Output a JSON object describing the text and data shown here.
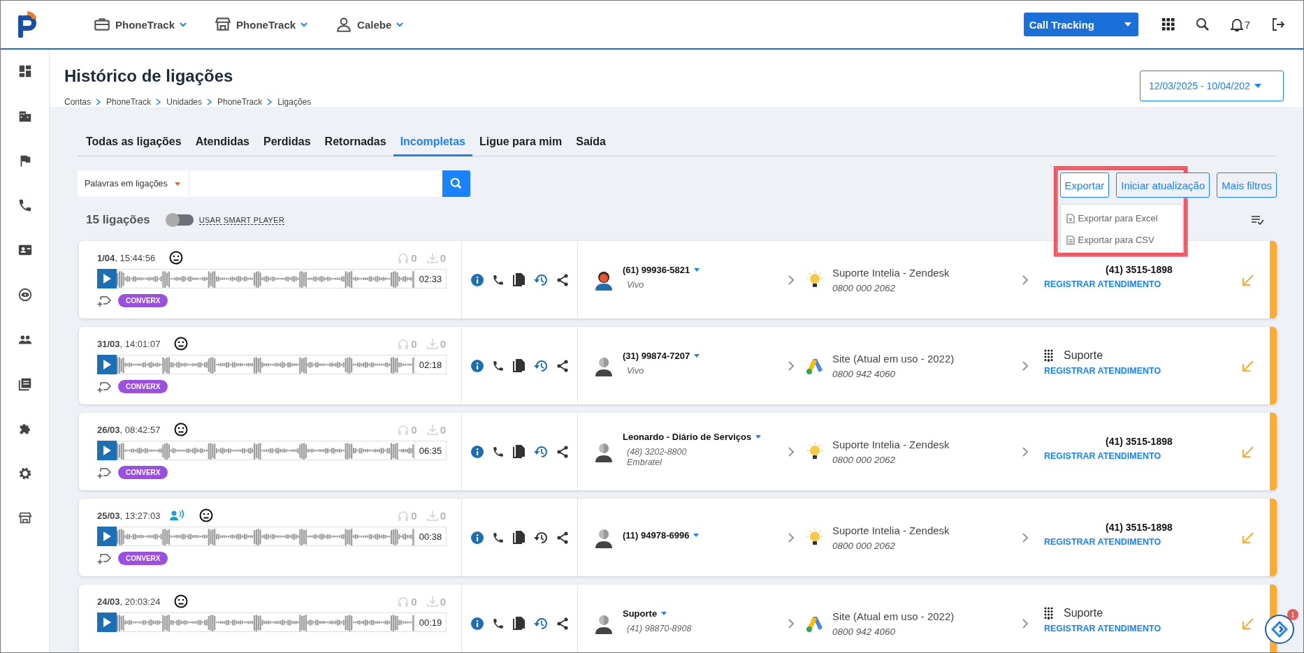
{
  "topbar": {
    "menus": [
      {
        "label": "PhoneTrack"
      },
      {
        "label": "PhoneTrack"
      },
      {
        "label": "Calebe"
      }
    ],
    "product": "Call Tracking",
    "notifications": "7"
  },
  "sidebar": {
    "items": [
      {
        "kind": "dashboard"
      },
      {
        "kind": "building"
      },
      {
        "kind": "flag"
      },
      {
        "kind": "phone"
      },
      {
        "kind": "contact"
      },
      {
        "kind": "target"
      },
      {
        "kind": "people"
      },
      {
        "kind": "book"
      },
      {
        "kind": "puzzle"
      },
      {
        "kind": "gear"
      },
      {
        "kind": "store"
      }
    ]
  },
  "header": {
    "title": "Histórico de ligações",
    "breadcrumb": [
      "Contas",
      "PhoneTrack",
      "Unidades",
      "PhoneTrack",
      "Ligações"
    ],
    "date_range": "12/03/2025 - 10/04/202"
  },
  "tabs": [
    {
      "label": "Todas as ligações",
      "selected": false
    },
    {
      "label": "Atendidas",
      "selected": false
    },
    {
      "label": "Perdidas",
      "selected": false
    },
    {
      "label": "Retornadas",
      "selected": false
    },
    {
      "label": "Incompletas",
      "selected": true
    },
    {
      "label": "Ligue para mim",
      "selected": false
    },
    {
      "label": "Saída",
      "selected": false
    }
  ],
  "search": {
    "filter": "Palavras em ligações"
  },
  "actions": [
    {
      "label": "Exportar",
      "expanded": true
    },
    {
      "label": "Iniciar atualização",
      "expanded": false
    },
    {
      "label": "Mais filtros",
      "expanded": false
    }
  ],
  "export_menu": {
    "highlighted": true,
    "items": [
      {
        "kind": "excel",
        "label": "Exportar para Excel"
      },
      {
        "kind": "csv",
        "label": "Exportar para CSV"
      }
    ]
  },
  "summary": {
    "count": "15 ligações",
    "smart_player": {
      "label": "USAR SMART PLAYER",
      "on": false
    }
  },
  "calls": [
    {
      "datetime": "**1/04**, 15:44:56",
      "transcribed": false,
      "plays": "0",
      "downloads": "0",
      "duration": "02:33",
      "tags": [
        "CONVERX"
      ],
      "history_highlighted": true,
      "caller": {
        "kind": "woman",
        "name": "(61) 99936-5821",
        "lines": [
          "Vivo"
        ]
      },
      "source": {
        "kind": "bulb",
        "name": "Suporte Intelia - Zendesk",
        "number": "0800 000 2062"
      },
      "destination": {
        "kind": "phone",
        "label": "(41) 3515-1898",
        "action": "REGISTRAR ATENDIMENTO"
      }
    },
    {
      "datetime": "**31/03**, 14:01:07",
      "transcribed": false,
      "plays": "0",
      "downloads": "0",
      "duration": "02:18",
      "tags": [
        "CONVERX"
      ],
      "history_highlighted": true,
      "caller": {
        "kind": "person",
        "name": "(31) 99874-7207",
        "lines": [
          "Vivo"
        ]
      },
      "source": {
        "kind": "ads",
        "name": "Site (Atual em uso - 2022)",
        "number": "0800 942 4060"
      },
      "destination": {
        "kind": "menu",
        "label": "Suporte",
        "action": "REGISTRAR ATENDIMENTO"
      }
    },
    {
      "datetime": "**26/03**, 08:42:57",
      "transcribed": false,
      "plays": "0",
      "downloads": "0",
      "duration": "06:35",
      "tags": [
        "CONVERX"
      ],
      "history_highlighted": true,
      "caller": {
        "kind": "person",
        "name": "Leonardo - Diário de Serviços",
        "lines": [
          "(48) 3202-8800",
          "Embratel"
        ]
      },
      "source": {
        "kind": "bulb",
        "name": "Suporte Intelia - Zendesk",
        "number": "0800 000 2062"
      },
      "destination": {
        "kind": "phone",
        "label": "(41) 3515-1898",
        "action": "REGISTRAR ATENDIMENTO"
      }
    },
    {
      "datetime": "**25/03**, 13:27:03",
      "transcribed": true,
      "plays": "0",
      "downloads": "0",
      "duration": "00:38",
      "tags": [
        "CONVERX"
      ],
      "history_highlighted": false,
      "caller": {
        "kind": "person",
        "name": "(11) 94978-6996"
      },
      "source": {
        "kind": "bulb",
        "name": "Suporte Intelia - Zendesk",
        "number": "0800 000 2062"
      },
      "destination": {
        "kind": "phone",
        "label": "(41) 3515-1898",
        "action": "REGISTRAR ATENDIMENTO"
      }
    },
    {
      "datetime": "**24/03**, 20:03:24",
      "transcribed": false,
      "plays": "0",
      "downloads": "0",
      "duration": "00:19",
      "history_highlighted": true,
      "caller": {
        "kind": "person",
        "name": "Suporte",
        "lines": [
          "(41) 98870-8908"
        ]
      },
      "source": {
        "kind": "ads",
        "name": "Site (Atual em uso - 2022)",
        "number": "0800 942 4060"
      },
      "destination": {
        "kind": "menu",
        "label": "Suporte",
        "action": "REGISTRAR ATENDIMENTO"
      }
    }
  ],
  "chat_widget": {
    "badge": "1"
  }
}
